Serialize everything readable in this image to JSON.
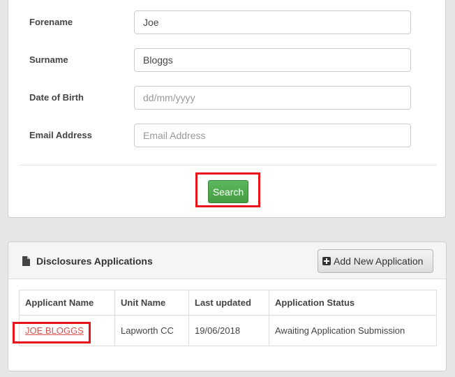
{
  "search_form": {
    "fields": [
      {
        "label": "Forename",
        "value": "Joe",
        "placeholder": ""
      },
      {
        "label": "Surname",
        "value": "Bloggs",
        "placeholder": ""
      },
      {
        "label": "Date of Birth",
        "value": "",
        "placeholder": "dd/mm/yyyy"
      },
      {
        "label": "Email Address",
        "value": "",
        "placeholder": "Email Address"
      }
    ],
    "search_label": "Search"
  },
  "applications": {
    "title": "Disclosures Applications",
    "add_button_label": "Add New Application",
    "columns": [
      "Applicant Name",
      "Unit Name",
      "Last updated",
      "Application Status"
    ],
    "rows": [
      {
        "applicant_name": "JOE BLOGGS",
        "unit_name": "Lapworth CC",
        "last_updated": "19/06/2018",
        "status": "Awaiting Application Submission"
      }
    ]
  },
  "colors": {
    "page_background": "#e6e6e6",
    "search_button": "#5cb85c",
    "highlight_box": "#e8141b",
    "link": "#d9534f"
  },
  "icons": {
    "header_icon": "document-icon",
    "add_button_icon": "plus-square-icon"
  }
}
